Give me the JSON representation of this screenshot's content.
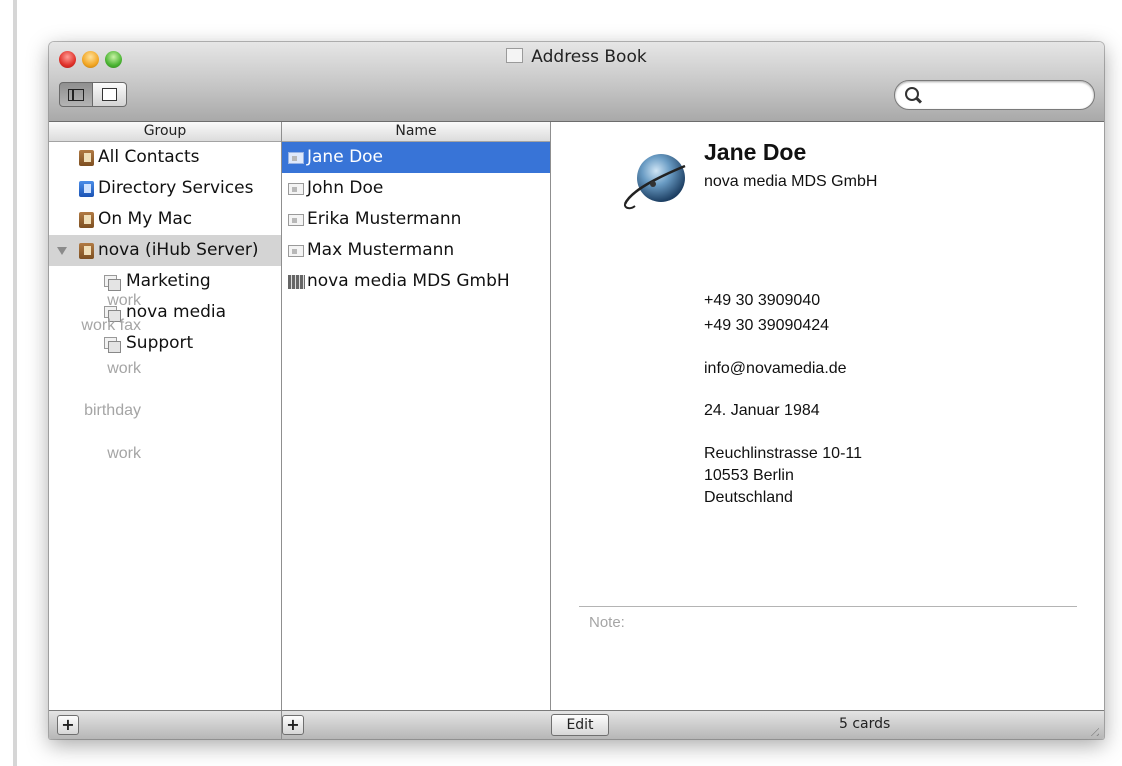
{
  "window": {
    "title": "Address Book"
  },
  "toolbar": {
    "view_buttons": [
      "card-and-columns-icon",
      "card-only-icon"
    ],
    "search": {
      "placeholder": "",
      "icon": "search-icon"
    }
  },
  "groups": {
    "header": "Group",
    "items": [
      {
        "label": "All Contacts",
        "icon": "address-book-icon"
      },
      {
        "label": "Directory Services",
        "icon": "directory-icon"
      },
      {
        "label": "On My Mac",
        "icon": "address-book-icon"
      },
      {
        "label": "nova (iHub Server)",
        "icon": "address-book-icon",
        "expanded": true,
        "selected": true
      },
      {
        "label": "Marketing",
        "icon": "group-icon"
      },
      {
        "label": "nova media",
        "icon": "group-icon"
      },
      {
        "label": "Support",
        "icon": "group-icon"
      }
    ]
  },
  "names": {
    "header": "Name",
    "items": [
      {
        "label": "Jane Doe",
        "icon": "card-icon",
        "selected": true
      },
      {
        "label": "John Doe",
        "icon": "card-icon"
      },
      {
        "label": "Erika Mustermann",
        "icon": "card-icon"
      },
      {
        "label": "Max Mustermann",
        "icon": "card-icon"
      },
      {
        "label": "nova media MDS GmbH",
        "icon": "company-icon"
      }
    ]
  },
  "card": {
    "name": "Jane Doe",
    "company": "nova media MDS GmbH",
    "fields": [
      {
        "label": "work",
        "value": "+49 30 3909040"
      },
      {
        "label": "work fax",
        "value": "+49 30 39090424"
      },
      {
        "label": "work",
        "value": "info@novamedia.de"
      },
      {
        "label": "birthday",
        "value": "24. Januar 1984"
      },
      {
        "label": "work",
        "address": [
          "Reuchlinstrasse 10-11",
          "10553 Berlin",
          "Deutschland"
        ]
      }
    ],
    "note_label": "Note:"
  },
  "footer": {
    "add_group": "+",
    "add_name": "+",
    "edit": "Edit",
    "count": "5 cards"
  },
  "colors": {
    "selection": "#3874d7",
    "label_gray": "#a5a5a5"
  }
}
